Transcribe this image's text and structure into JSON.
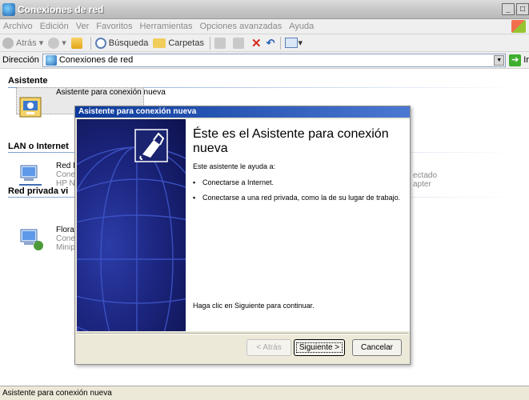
{
  "window": {
    "title": "Conexiones de red",
    "buttons": [
      "_",
      "□",
      "×"
    ]
  },
  "menu": [
    "Archivo",
    "Edición",
    "Ver",
    "Favoritos",
    "Herramientas",
    "Opciones avanzadas",
    "Ayuda"
  ],
  "toolbar": {
    "back": "Atrás",
    "search": "Búsqueda",
    "folders": "Carpetas"
  },
  "address": {
    "label": "Dirección",
    "value": "Conexiones de red",
    "go": "Ir"
  },
  "groups": [
    {
      "title": "Asistente"
    },
    {
      "title": "LAN o Internet"
    },
    {
      "title": "Red privada vi"
    }
  ],
  "items": {
    "wizard": {
      "label": "Asistente para conexión nueva"
    },
    "lan": {
      "line1": "Red F",
      "line2": "Conec",
      "line3": "HP NC",
      "status_right": "ectado",
      "adapter_right": "apter"
    },
    "vpn": {
      "line1": "Floral",
      "line2": "Conec",
      "line3": "Minipu"
    }
  },
  "dialog": {
    "title": "Asistente para conexión nueva",
    "heading": "Éste es el Asistente para conexión nueva",
    "intro": "Este asistente le ayuda a:",
    "bullets": [
      "Conectarse a Internet.",
      "Conectarse a una red privada, como la de su lugar de trabajo."
    ],
    "continue": "Haga clic en Siguiente para continuar.",
    "buttons": {
      "back": "< Atrás",
      "next": "Siguiente >",
      "cancel": "Cancelar"
    }
  },
  "statusbar": "Asistente para conexión nueva"
}
